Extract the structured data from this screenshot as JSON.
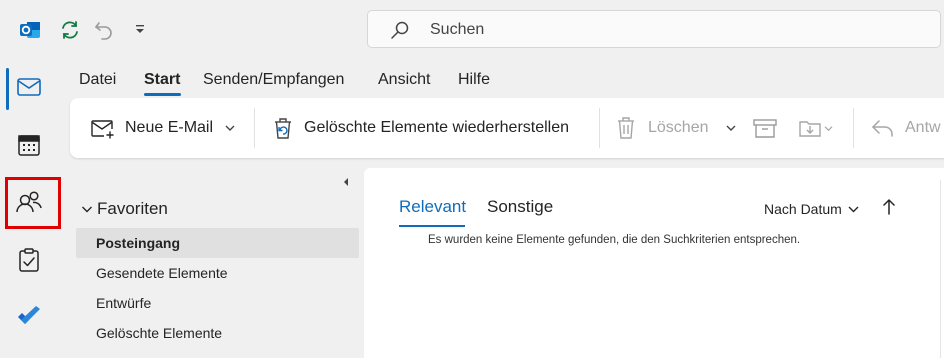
{
  "titlebar": {
    "search_placeholder": "Suchen"
  },
  "rail": {
    "items": [
      "mail",
      "calendar",
      "people",
      "tasks",
      "todo"
    ],
    "active": "mail",
    "highlighted": "people"
  },
  "menu": {
    "tabs": [
      "Datei",
      "Start",
      "Senden/Empfangen",
      "Ansicht",
      "Hilfe"
    ],
    "active": "Start"
  },
  "ribbon": {
    "new_mail": "Neue E-Mail",
    "restore_deleted": "Gelöschte Elemente wiederherstellen",
    "delete": "Löschen",
    "reply_truncated": "Antw"
  },
  "folders": {
    "favorites_label": "Favoriten",
    "items": [
      "Posteingang",
      "Gesendete Elemente",
      "Entwürfe",
      "Gelöschte Elemente"
    ],
    "selected": "Posteingang"
  },
  "message_list": {
    "tab_focused": "Relevant",
    "tab_other": "Sonstige",
    "sort_label": "Nach Datum",
    "empty_text": "Es wurden keine Elemente gefunden, die den Suchkriterien entsprechen."
  },
  "colors": {
    "accent": "#0f6cbd",
    "highlight": "#e00000"
  }
}
